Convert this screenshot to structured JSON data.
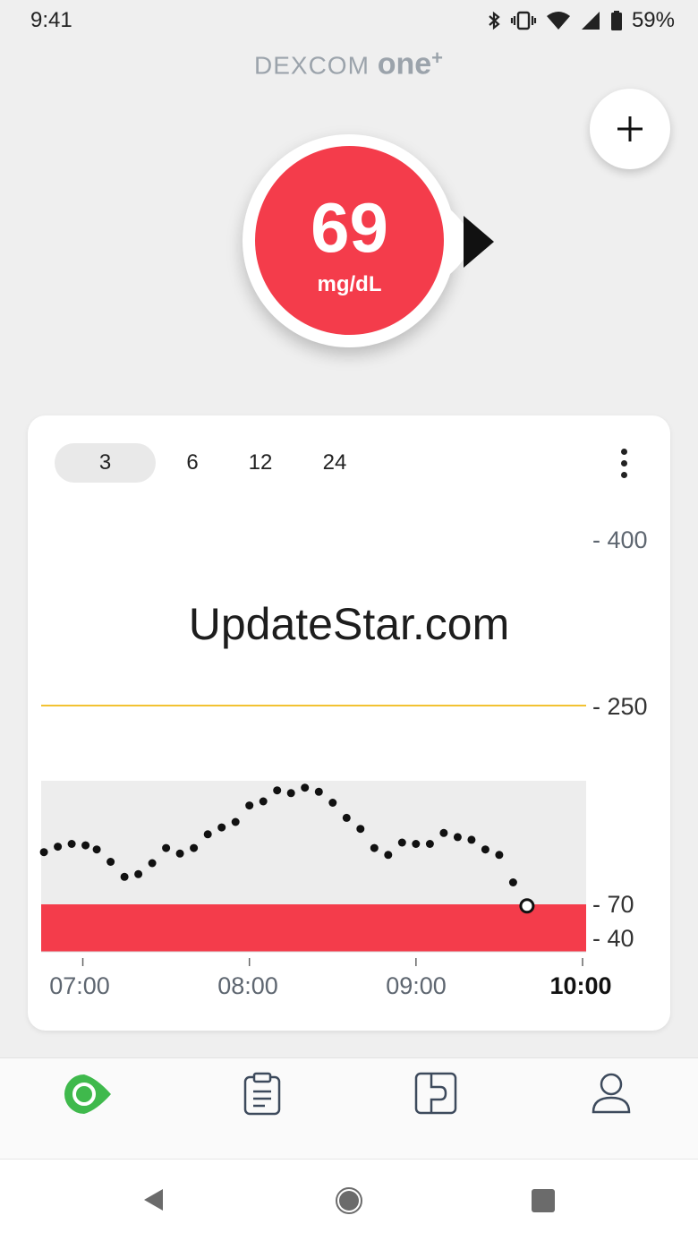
{
  "status_bar": {
    "time": "9:41",
    "battery": "59%",
    "icons": [
      "bluetooth-icon",
      "vibrate-icon",
      "wifi-icon",
      "signal-icon",
      "battery-icon"
    ]
  },
  "app": {
    "logo_text": "DEXCOM",
    "logo_one": "one",
    "logo_plus": "+"
  },
  "reading": {
    "value": "69",
    "unit": "mg/dL",
    "color": "#f43c4b",
    "trend": "trend-arrow-right-icon"
  },
  "chart_controls": {
    "ranges": [
      "3",
      "6",
      "12",
      "24"
    ],
    "selected": "3"
  },
  "watermark": "UpdateStar.com",
  "chart_data": {
    "type": "scatter",
    "x_ticks": [
      "07:00",
      "08:00",
      "09:00",
      "10:00"
    ],
    "y_ticks": [
      "400",
      "250",
      "70",
      "40"
    ],
    "high_threshold": 250,
    "low_threshold": 70,
    "urgent_low": 40,
    "target_band_top_y": 160,
    "colors": {
      "high_line": "#f2c232",
      "low_band": "#f43c4b",
      "in_range_band": "#ededed",
      "points": "#111111"
    },
    "x_start": "06:45",
    "x_end": "10:00",
    "points": [
      {
        "time": "06:46",
        "value": 108
      },
      {
        "time": "06:51",
        "value": 112
      },
      {
        "time": "06:56",
        "value": 114
      },
      {
        "time": "07:01",
        "value": 113
      },
      {
        "time": "07:05",
        "value": 110
      },
      {
        "time": "07:10",
        "value": 101
      },
      {
        "time": "07:15",
        "value": 90
      },
      {
        "time": "07:20",
        "value": 92
      },
      {
        "time": "07:25",
        "value": 100
      },
      {
        "time": "07:30",
        "value": 111
      },
      {
        "time": "07:35",
        "value": 107
      },
      {
        "time": "07:40",
        "value": 111
      },
      {
        "time": "07:45",
        "value": 121
      },
      {
        "time": "07:50",
        "value": 126
      },
      {
        "time": "07:55",
        "value": 130
      },
      {
        "time": "08:00",
        "value": 142
      },
      {
        "time": "08:05",
        "value": 145
      },
      {
        "time": "08:10",
        "value": 153
      },
      {
        "time": "08:15",
        "value": 151
      },
      {
        "time": "08:20",
        "value": 155
      },
      {
        "time": "08:25",
        "value": 152
      },
      {
        "time": "08:30",
        "value": 144
      },
      {
        "time": "08:35",
        "value": 133
      },
      {
        "time": "08:40",
        "value": 125
      },
      {
        "time": "08:45",
        "value": 111
      },
      {
        "time": "08:50",
        "value": 106
      },
      {
        "time": "08:55",
        "value": 115
      },
      {
        "time": "09:00",
        "value": 114
      },
      {
        "time": "09:05",
        "value": 114
      },
      {
        "time": "09:10",
        "value": 122
      },
      {
        "time": "09:15",
        "value": 119
      },
      {
        "time": "09:20",
        "value": 117
      },
      {
        "time": "09:25",
        "value": 110
      },
      {
        "time": "09:30",
        "value": 106
      },
      {
        "time": "09:35",
        "value": 86
      },
      {
        "time": "09:40",
        "value": 69,
        "current": true
      }
    ]
  },
  "bottom_nav": [
    {
      "name": "nav-glucose",
      "icon": "glucose-trend-icon",
      "active": true
    },
    {
      "name": "nav-events",
      "icon": "clipboard-icon",
      "active": false
    },
    {
      "name": "nav-connections",
      "icon": "sensor-connection-icon",
      "active": false
    },
    {
      "name": "nav-profile",
      "icon": "profile-icon",
      "active": false
    }
  ]
}
